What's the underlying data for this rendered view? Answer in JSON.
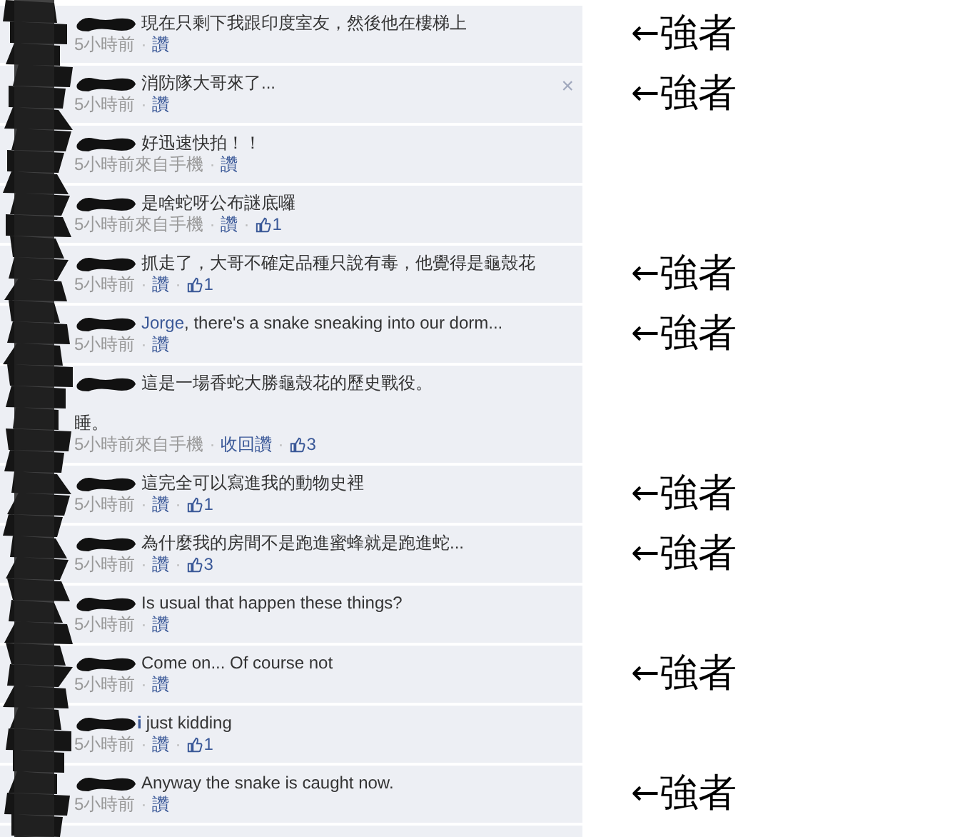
{
  "comments": [
    {
      "text": "現在只剩下我跟印度室友，然後他在樓梯上",
      "time": "5小時前",
      "separators": [
        "·"
      ],
      "like_label": "讚",
      "annotation": {
        "arrow": "←",
        "text": "強者"
      }
    },
    {
      "text": "消防隊大哥來了...",
      "time": "5小時前",
      "separators": [
        "·"
      ],
      "like_label": "讚",
      "close": "×",
      "annotation": {
        "arrow": "←",
        "text": "強者"
      }
    },
    {
      "text": "好迅速快拍！！",
      "time": "5小時前來自手機",
      "separators": [
        "·"
      ],
      "like_label": "讚"
    },
    {
      "text": "是啥蛇呀公布謎底囉",
      "time": "5小時前來自手機",
      "separators": [
        "·",
        "·"
      ],
      "like_label": "讚",
      "likes": "1"
    },
    {
      "text": "抓走了，大哥不確定品種只說有毒，他覺得是龜殼花",
      "time": "5小時前",
      "separators": [
        "·",
        "·"
      ],
      "like_label": "讚",
      "likes": "1",
      "annotation": {
        "arrow": "←",
        "text": "強者"
      }
    },
    {
      "mention": "Jorge",
      "text": ", there's a snake sneaking into our dorm...",
      "time": "5小時前",
      "separators": [
        "·"
      ],
      "like_label": "讚",
      "annotation": {
        "arrow": "←",
        "text": "強者"
      }
    },
    {
      "text": "這是一場香蛇大勝龜殼花的歷史戰役。",
      "extra_line": "睡。",
      "time": "5小時前來自手機",
      "separators": [
        "·",
        "·"
      ],
      "like_label": "收回讚",
      "likes": "3"
    },
    {
      "text": "這完全可以寫進我的動物史裡",
      "time": "5小時前",
      "separators": [
        "·",
        "·"
      ],
      "like_label": "讚",
      "likes": "1",
      "annotation": {
        "arrow": "←",
        "text": "強者"
      }
    },
    {
      "text": "為什麼我的房間不是跑進蜜蜂就是跑進蛇...",
      "time": "5小時前",
      "separators": [
        "·",
        "·"
      ],
      "like_label": "讚",
      "likes": "3",
      "annotation": {
        "arrow": "←",
        "text": "強者"
      }
    },
    {
      "text": "Is usual that happen these things?",
      "time": "5小時前",
      "separators": [
        "·"
      ],
      "like_label": "讚"
    },
    {
      "text": "Come on... Of course not",
      "time": "5小時前",
      "separators": [
        "·"
      ],
      "like_label": "讚",
      "annotation": {
        "arrow": "←",
        "text": "強者"
      }
    },
    {
      "name_fragment": "i",
      "text": "just kidding",
      "time": "5小時前",
      "separators": [
        "·",
        "·"
      ],
      "like_label": "讚",
      "likes": "1"
    },
    {
      "text": "Anyway the snake is caught now.",
      "time": "5小時前",
      "separators": [
        "·"
      ],
      "like_label": "讚",
      "annotation": {
        "arrow": "←",
        "text": "強者"
      }
    }
  ]
}
